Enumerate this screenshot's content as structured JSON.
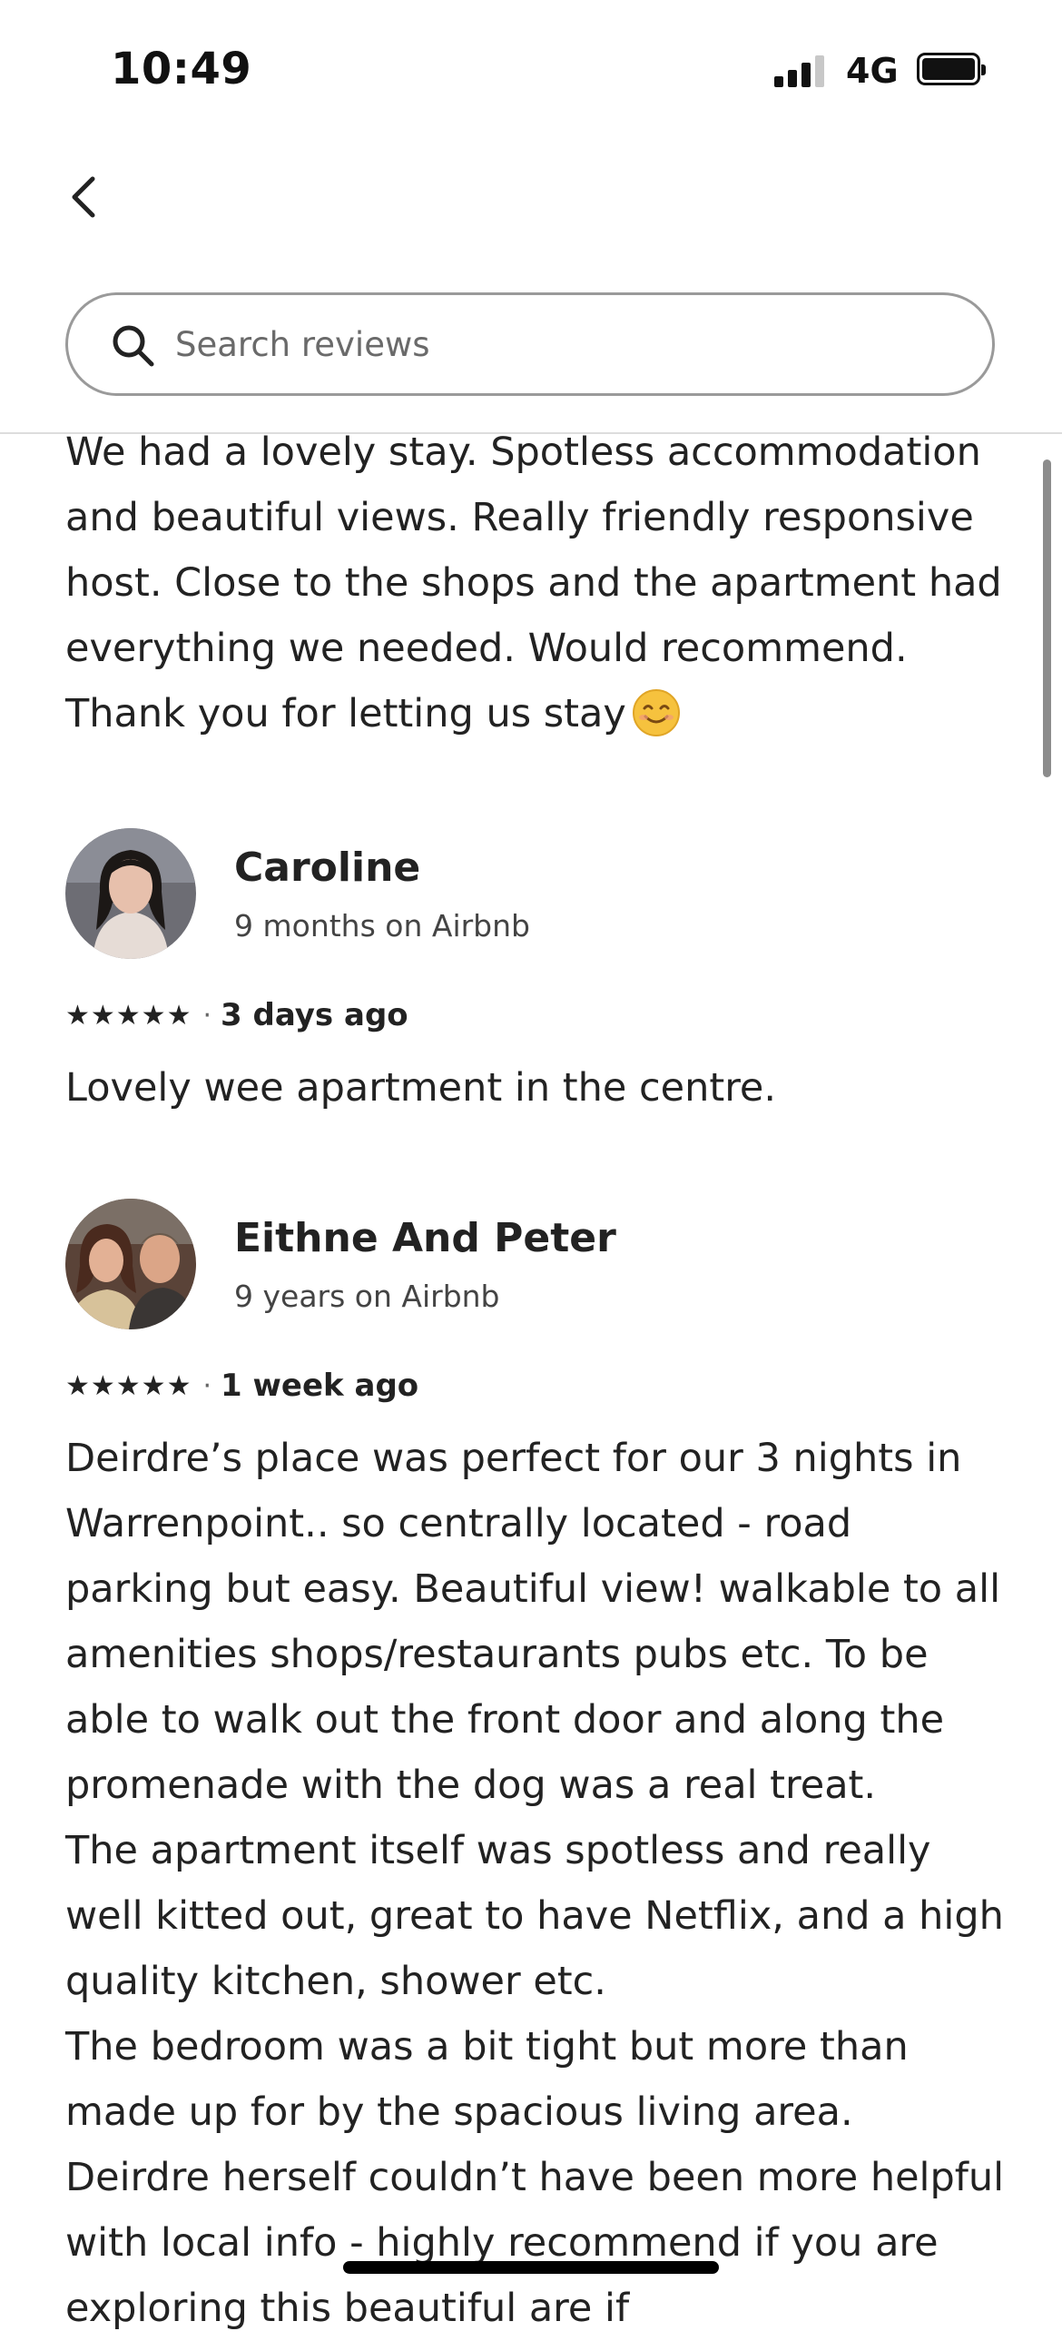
{
  "status_bar": {
    "time": "10:49",
    "network": "4G",
    "signal_level": 3,
    "signal_max": 4,
    "battery_level": 1.0
  },
  "nav": {
    "back_icon": "chevron-left-icon"
  },
  "search": {
    "icon": "search-icon",
    "placeholder": "Search reviews",
    "value": ""
  },
  "previous_review": {
    "text": "We had a lovely stay. Spotless accommodation and beautiful views. Really friendly responsive host. Close to the shops and the apartment had everything we needed. Would recommend. Thank you for letting us stay",
    "emoji": "smiling-face-icon"
  },
  "reviews": [
    {
      "name": "Caroline",
      "tenure": "9 months on Airbnb",
      "rating": 5,
      "stars": "★★★★★",
      "separator": "·",
      "date": "3 days ago",
      "text": "Lovely wee apartment in the centre."
    },
    {
      "name": "Eithne And Peter",
      "tenure": "9 years on Airbnb",
      "rating": 5,
      "stars": "★★★★★",
      "separator": "·",
      "date": "1 week ago",
      "text": "Deirdre’s place was perfect for our 3 nights in Warrenpoint.. so centrally located - road parking but easy. Beautiful view! walkable to all amenities shops/restaurants pubs etc. To be able to walk out the front door and along the promenade with the dog was a real treat.\nThe apartment itself was spotless and really well kitted out, great to have Netflix, and a high quality kitchen, shower etc.\nThe bedroom was a bit tight but more than made up for by the spacious living area.\nDeirdre herself couldn’t have been more helpful with local info - highly recommend if you are exploring this beautiful are if"
    }
  ],
  "colors": {
    "text": "#222222",
    "muted": "#6a6a6a",
    "border": "#9a9a9a",
    "divider": "#dddddd",
    "emoji": "#f6c23e"
  }
}
